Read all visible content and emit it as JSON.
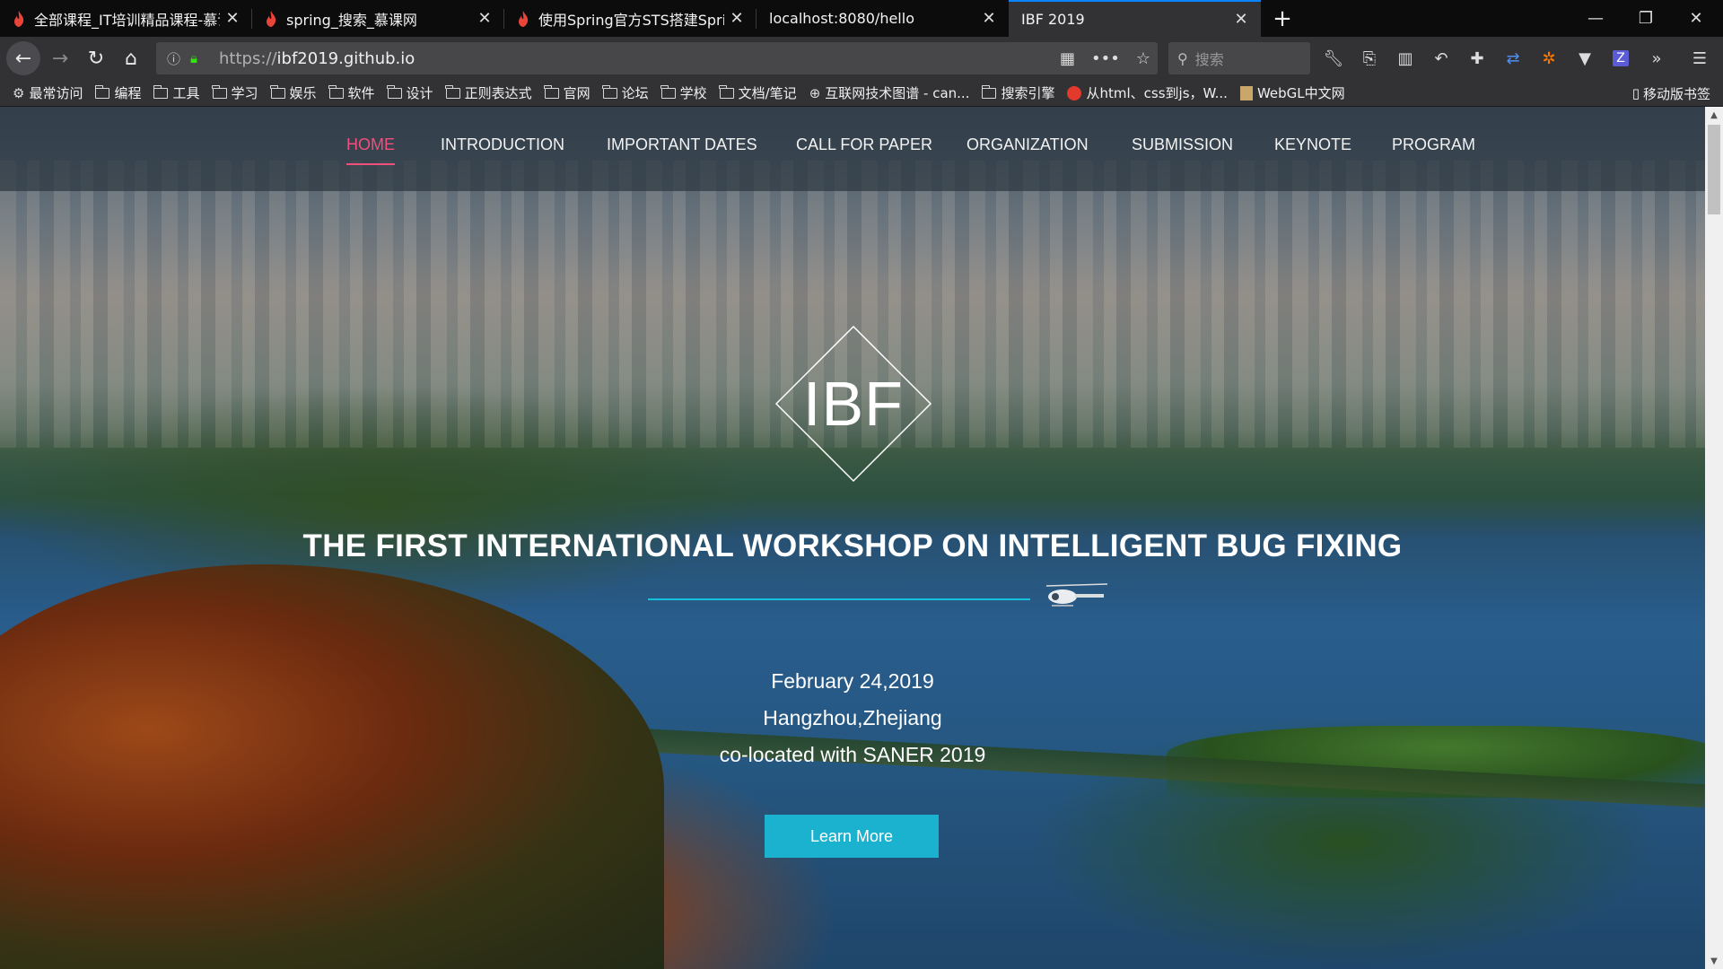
{
  "browser": {
    "tabs": [
      {
        "title": "全部课程_IT培训精品课程-慕课",
        "favicon": "flame-icon"
      },
      {
        "title": "spring_搜索_慕课网",
        "favicon": "flame-icon"
      },
      {
        "title": "使用Spring官方STS搭建Sprinc",
        "favicon": "flame-icon"
      },
      {
        "title": "localhost:8080/hello",
        "favicon": ""
      },
      {
        "title": "IBF 2019",
        "favicon": ""
      }
    ],
    "new_tab_label": "+",
    "window_controls": {
      "minimize": "—",
      "restore": "❐",
      "close": "✕"
    },
    "url_protocol": "https://",
    "url_host": "ibf2019.github.io",
    "search_placeholder": "搜索",
    "bookmarks": [
      {
        "label": "最常访问",
        "icon": "gear-icon"
      },
      {
        "label": "编程",
        "icon": "folder-icon"
      },
      {
        "label": "工具",
        "icon": "folder-icon"
      },
      {
        "label": "学习",
        "icon": "folder-icon"
      },
      {
        "label": "娱乐",
        "icon": "folder-icon"
      },
      {
        "label": "软件",
        "icon": "folder-icon"
      },
      {
        "label": "设计",
        "icon": "folder-icon"
      },
      {
        "label": "正则表达式",
        "icon": "folder-icon"
      },
      {
        "label": "官网",
        "icon": "folder-icon"
      },
      {
        "label": "论坛",
        "icon": "folder-icon"
      },
      {
        "label": "学校",
        "icon": "folder-icon"
      },
      {
        "label": "文档/笔记",
        "icon": "folder-icon"
      },
      {
        "label": "互联网技术图谱 - can...",
        "icon": "globe-icon"
      },
      {
        "label": "搜索引擎",
        "icon": "folder-icon"
      },
      {
        "label": "从html、css到js，W...",
        "icon": "html-badge-icon"
      },
      {
        "label": "WebGL中文网",
        "icon": "page-icon"
      }
    ],
    "mobile_bookmarks": "移动版书签"
  },
  "site": {
    "nav": [
      {
        "label": "HOME",
        "active": true
      },
      {
        "label": "INTRODUCTION",
        "active": false
      },
      {
        "label": "IMPORTANT DATES",
        "active": false
      },
      {
        "label": "CALL FOR PAPER",
        "active": false
      },
      {
        "label": "ORGANIZATION",
        "active": false
      },
      {
        "label": "SUBMISSION",
        "active": false
      },
      {
        "label": "KEYNOTE",
        "active": false
      },
      {
        "label": "PROGRAM",
        "active": false
      }
    ],
    "logo_text": "IBF",
    "headline": "THE FIRST INTERNATIONAL WORKSHOP ON INTELLIGENT BUG FIXING",
    "date": "February 24,2019",
    "location": "Hangzhou,Zhejiang",
    "colocated": "co-located with SANER 2019",
    "cta_label": "Learn More"
  },
  "colors": {
    "active_nav": "#f24f7c",
    "accent": "#1bb2cf",
    "divider": "#12c1d9",
    "tab_highlight": "#0a84ff"
  }
}
